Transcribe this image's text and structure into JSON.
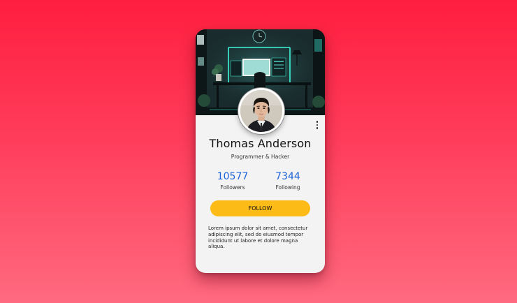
{
  "profile": {
    "name": "Thomas Anderson",
    "role": "Programmer & Hacker",
    "followers": {
      "count": "10577",
      "label": "Followers"
    },
    "following": {
      "count": "7344",
      "label": "Following"
    },
    "follow_label": "FOLLOW",
    "bio": "Lorem ipsum dolor sit amet, consectetur adipiscing elit, sed do eiusmod tempor incididunt ut labore et dolore magna aliqua."
  },
  "icons": {
    "menu": "more-vertical-icon",
    "cover": "neon-desk-setup-image",
    "avatar": "user-portrait-photo"
  },
  "colors": {
    "background_top": "#ff1e3f",
    "background_bottom": "#ff6a80",
    "card": "#f3f3f3",
    "accent_blue": "#1f63d8",
    "button_yellow": "#fcbb17",
    "neon_teal": "#3ff5d9"
  }
}
